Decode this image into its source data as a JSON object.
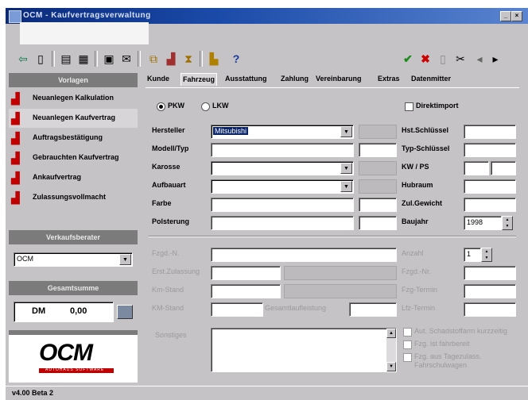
{
  "window": {
    "title": "OCM - Kaufvertragsverwaltung"
  },
  "toolbar": {
    "icons": [
      "exit-icon",
      "new-document-icon",
      "print-icon",
      "print-preview-icon",
      "save-icon",
      "mail-icon",
      "copy-icon",
      "paste-icon",
      "cut-icon",
      "open-folder-icon",
      "help-icon",
      "confirm-icon",
      "cancel-icon",
      "delete-icon",
      "scissors-icon",
      "previous-icon",
      "next-icon"
    ],
    "help_glyph": "?"
  },
  "left": {
    "vorlagen_header": "Vorlagen",
    "nav_items": [
      {
        "label": "Neuanlegen Kalkulation",
        "icon": "form-icon"
      },
      {
        "label": "Neuanlegen Kaufvertrag",
        "icon": "form-icon"
      },
      {
        "label": "Auftragsbestätigung",
        "icon": "form-icon"
      },
      {
        "label": "Gebrauchten Kaufvertrag",
        "icon": "form-icon"
      },
      {
        "label": "Ankaufvertrag",
        "icon": "form-icon"
      },
      {
        "label": "Zulassungsvollmacht",
        "icon": "form-icon"
      }
    ],
    "verkaufsberater_header": "Verkaufsberater",
    "verkaufsberater_value": "OCM",
    "gesamtsumme_header": "Gesamtsumme",
    "currency": "DM",
    "total": "0,00",
    "logo_text": "OCM",
    "logo_sub": "AUTOHAUS SOFTWARE",
    "status": "v4.00 Beta 2"
  },
  "tabs": [
    {
      "label": "Kunde",
      "active": false
    },
    {
      "label": "Fahrzeug",
      "active": true
    },
    {
      "label": "Ausstattung",
      "active": false
    },
    {
      "label": "Zahlung",
      "active": false
    },
    {
      "label": "Vereinbarung",
      "active": false
    },
    {
      "label": "Extras",
      "active": false
    },
    {
      "label": "Datenmitter",
      "active": false
    }
  ],
  "form": {
    "radio_pkw": "PKW",
    "radio_lkw": "LKW",
    "vorfuehrwagen": "Direktimport",
    "hersteller_label": "Hersteller",
    "hersteller_value": "Mitsubishi",
    "modell_label": "Modell/Typ",
    "karosse_label": "Karosse",
    "aufbauart_label": "Aufbauart",
    "farbe_label": "Farbe",
    "polsterung_label": "Polsterung",
    "hst_label": "Hst.Schlüssel",
    "typ_label": "Typ-Schlüssel",
    "kw_label": "KW / PS",
    "hubraum_label": "Hubraum",
    "zul_label": "Zul.Gewicht",
    "baujahr_label": "Baujahr",
    "baujahr_value": "1998",
    "fzgid_label": "Fzgd.-N.",
    "anzahl_label": "Anzahl",
    "anzahl_value": "1",
    "erstzul_label": "Erst.Zulassung",
    "fzgnr_label": "Fzgd.-Nr.",
    "kmstand_label": "Km-Stand",
    "fzgtermin_label": "Fzg-Termin",
    "km_label": "KM-Stand",
    "gesamtlaufl_label": "Gesamtlaufleistung",
    "liefertermin_label": "Lfz-Termin",
    "sonstiges_label": "Sonstiges",
    "check1": "Aut. Schadstoffarm kurzzeitig",
    "check2": "Fzg. ist fahrbereit",
    "check3": "Fzg. aus Tagezulass. Fahrschulwagen"
  }
}
